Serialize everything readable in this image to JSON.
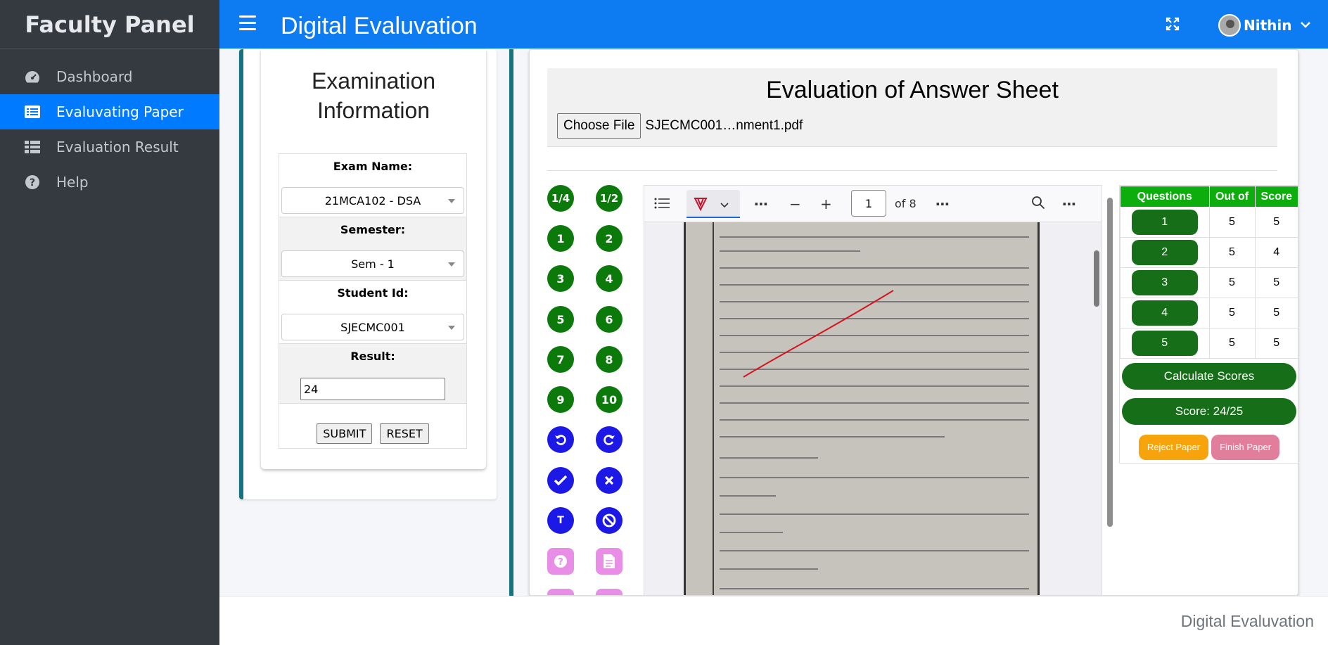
{
  "sidebar": {
    "brand": "Faculty Panel",
    "items": [
      {
        "label": "Dashboard",
        "icon": "gauge-icon"
      },
      {
        "label": "Evaluvating Paper",
        "icon": "list-icon"
      },
      {
        "label": "Evaluation Result",
        "icon": "table-icon"
      },
      {
        "label": "Help",
        "icon": "question-circle-icon"
      }
    ],
    "active_index": 1
  },
  "topbar": {
    "title": "Digital Evaluvation",
    "user": "Nithin"
  },
  "exam": {
    "title": "Examination Information",
    "exam_name_label": "Exam Name:",
    "exam_name_value": "21MCA102 - DSA",
    "semester_label": "Semester:",
    "semester_value": "Sem - 1",
    "student_id_label": "Student Id:",
    "student_id_value": "SJECMC001",
    "result_label": "Result:",
    "result_value": "24",
    "submit_label": "SUBMIT",
    "reset_label": "RESET"
  },
  "evaluation": {
    "title": "Evaluation of Answer Sheet",
    "choose_file_label": "Choose File",
    "file_name": "SJECMC001…nment1.pdf",
    "tools": {
      "quarter": "1/4",
      "half": "1/2",
      "numbers": [
        "1",
        "2",
        "3",
        "4",
        "5",
        "6",
        "7",
        "8",
        "9",
        "10"
      ],
      "text_tool": "T"
    },
    "pdf": {
      "current_page": "1",
      "page_count_label": "of 8"
    },
    "scores": {
      "headers": [
        "Questions",
        "Out of",
        "Score"
      ],
      "rows": [
        {
          "q": "1",
          "out_of": "5",
          "score": "5"
        },
        {
          "q": "2",
          "out_of": "5",
          "score": "4"
        },
        {
          "q": "3",
          "out_of": "5",
          "score": "5"
        },
        {
          "q": "4",
          "out_of": "5",
          "score": "5"
        },
        {
          "q": "5",
          "out_of": "5",
          "score": "5"
        }
      ],
      "calculate_label": "Calculate Scores",
      "total_label": "Score: 24/25",
      "reject_label": "Reject Paper",
      "finish_label": "Finish Paper"
    }
  },
  "footer": {
    "text": "Digital Evaluvation"
  },
  "colors": {
    "primary": "#0d7cf2",
    "sidebar": "#343a40",
    "accent_teal": "#17727f",
    "green": "#166e18",
    "header_green": "#0cad0c",
    "blue_tool": "#1c19e6",
    "pink_tool": "#e98ee6",
    "reject": "#f7a40c",
    "finish": "#e07e9b"
  }
}
